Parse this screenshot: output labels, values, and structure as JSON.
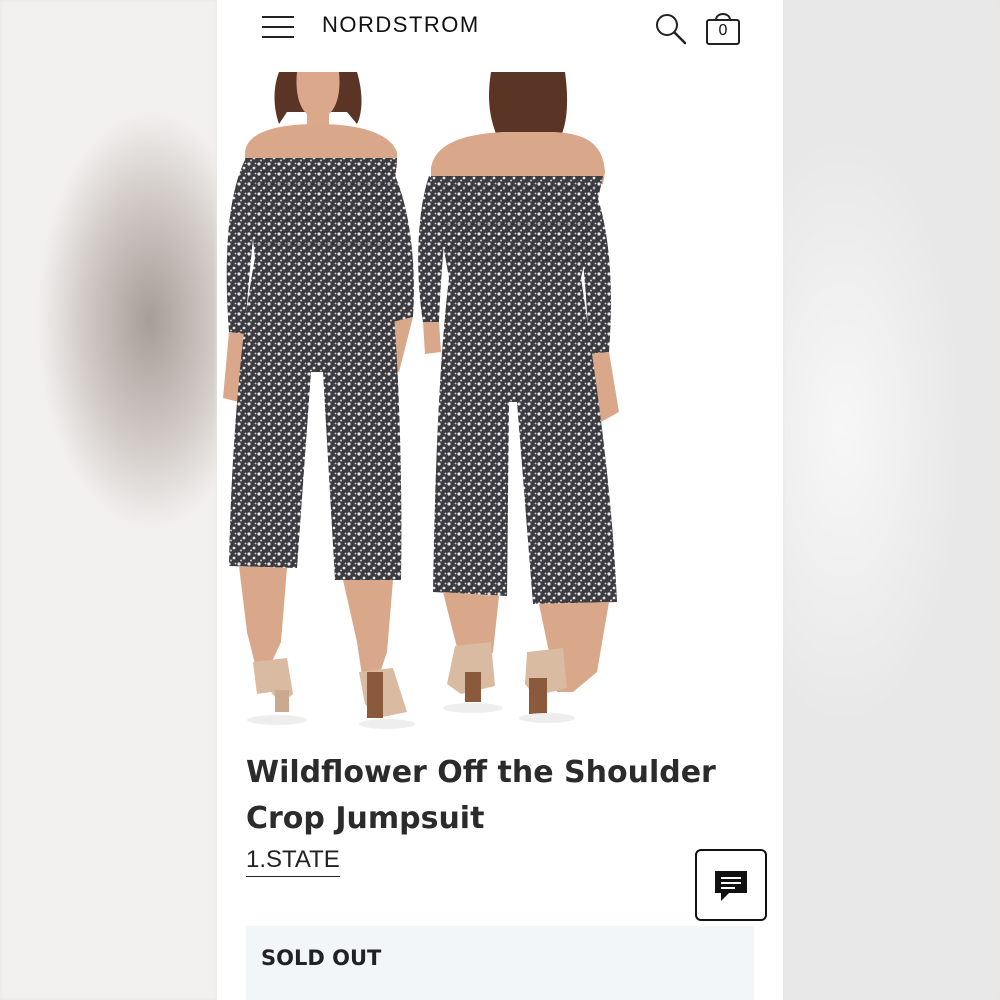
{
  "header": {
    "brand": "NORDSTROM",
    "bag_count": "0"
  },
  "product": {
    "title": "Wildflower Off the Shoulder Crop Jumpsuit",
    "brand_name": "1.STATE",
    "status": "SOLD OUT"
  },
  "colors": {
    "fabric_dark": "#2a2a2e",
    "fabric_light": "#e8e6ea",
    "skin": "#d9a78a",
    "hair": "#5a3526",
    "sandal": "#d8bba0",
    "heel": "#8b5a3c",
    "sold_out_bg": "#f2f6f9"
  },
  "icons": [
    "menu-icon",
    "search-icon",
    "shopping-bag-icon",
    "chat-icon"
  ]
}
